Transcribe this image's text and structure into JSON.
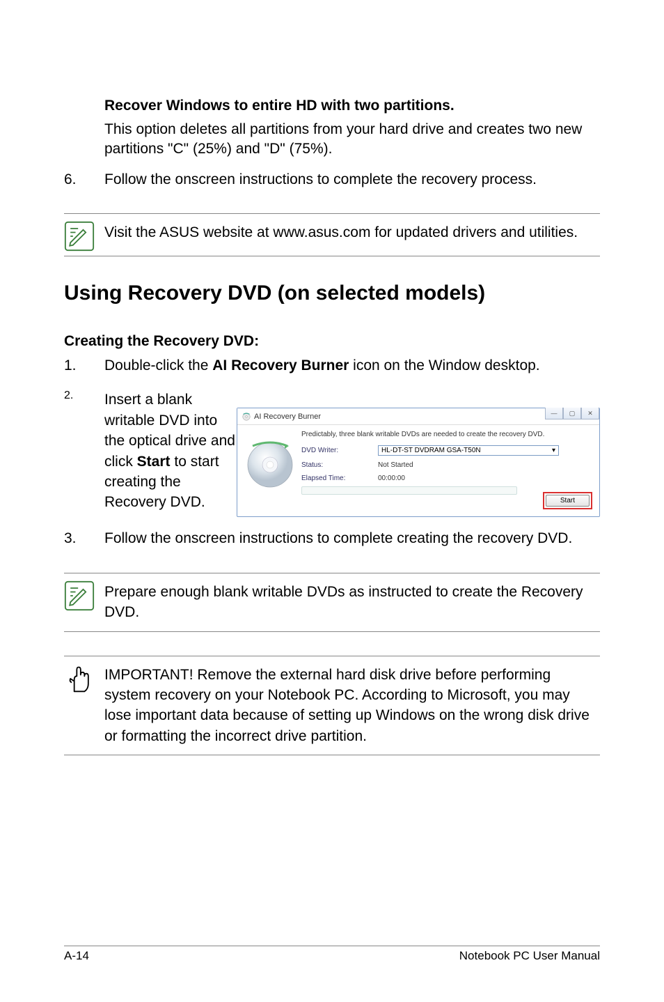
{
  "option": {
    "heading": "Recover Windows to entire HD with two partitions.",
    "desc": "This option deletes all partitions from your hard drive and creates two new partitions \"C\" (25%) and \"D\" (75%)."
  },
  "step6": {
    "num": "6.",
    "text": "Follow the onscreen instructions to complete the recovery process."
  },
  "note1": "Visit the ASUS website at www.asus.com for updated drivers and utilities.",
  "section_heading": "Using Recovery DVD (on selected models)",
  "subheading": "Creating the Recovery DVD:",
  "step1": {
    "num": "1.",
    "pre": "Double-click the ",
    "bold": "AI Recovery Burner",
    "post": " icon on the Window desktop."
  },
  "step2": {
    "num": "2.",
    "pre": "Insert a blank writable DVD into the optical drive and click ",
    "bold": "Start",
    "post": " to start creating the Recovery DVD."
  },
  "step3": {
    "num": "3.",
    "text": "Follow the onscreen instructions to complete creating the recovery DVD."
  },
  "note2": "Prepare enough blank writable DVDs as instructed to create the Recovery DVD.",
  "important": "IMPORTANT! Remove the external hard disk drive before performing system recovery on your Notebook PC. According to Microsoft, you may lose important data because of setting up Windows on the wrong disk drive or formatting the incorrect drive partition.",
  "screenshot": {
    "title": "AI Recovery Burner",
    "predict": "Predictably, three blank writable DVDs are needed to create the recovery DVD.",
    "dvd_writer_label": "DVD Writer:",
    "dvd_writer_value": "HL-DT-ST DVDRAM GSA-T50N",
    "status_label": "Status:",
    "status_value": "Not Started",
    "elapsed_label": "Elapsed Time:",
    "elapsed_value": "00:00:00",
    "start_button": "Start"
  },
  "footer": {
    "left": "A-14",
    "right": "Notebook PC User Manual"
  }
}
